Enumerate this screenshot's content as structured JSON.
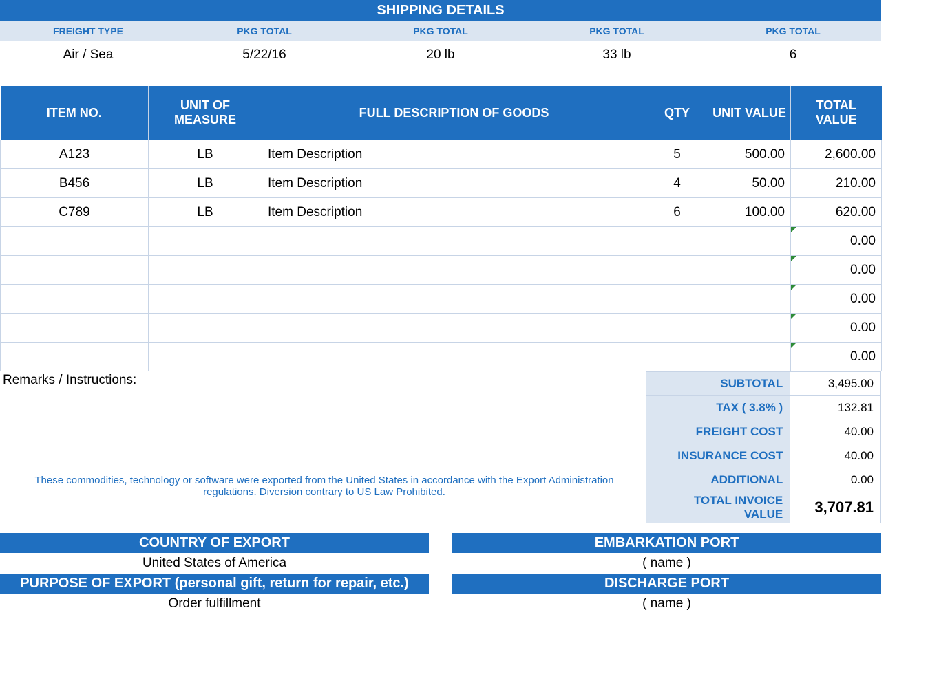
{
  "shipping": {
    "title": "SHIPPING DETAILS",
    "headers": [
      "FREIGHT TYPE",
      "PKG TOTAL",
      "PKG TOTAL",
      "PKG TOTAL",
      "PKG TOTAL"
    ],
    "values": [
      "Air / Sea",
      "5/22/16",
      "20 lb",
      "33 lb",
      "6"
    ]
  },
  "items_table": {
    "headers": {
      "item": "ITEM NO.",
      "uom": "UNIT OF MEASURE",
      "desc": "FULL DESCRIPTION OF GOODS",
      "qty": "QTY",
      "uval": "UNIT VALUE",
      "tval": "TOTAL VALUE"
    },
    "rows": [
      {
        "item": "A123",
        "uom": "LB",
        "desc": "Item Description",
        "qty": "5",
        "uval": "500.00",
        "tval": "2,600.00"
      },
      {
        "item": "B456",
        "uom": "LB",
        "desc": "Item Description",
        "qty": "4",
        "uval": "50.00",
        "tval": "210.00"
      },
      {
        "item": "C789",
        "uom": "LB",
        "desc": "Item Description",
        "qty": "6",
        "uval": "100.00",
        "tval": "620.00"
      },
      {
        "item": "",
        "uom": "",
        "desc": "",
        "qty": "",
        "uval": "",
        "tval": "0.00",
        "flag": true
      },
      {
        "item": "",
        "uom": "",
        "desc": "",
        "qty": "",
        "uval": "",
        "tval": "0.00",
        "flag": true
      },
      {
        "item": "",
        "uom": "",
        "desc": "",
        "qty": "",
        "uval": "",
        "tval": "0.00",
        "flag": true
      },
      {
        "item": "",
        "uom": "",
        "desc": "",
        "qty": "",
        "uval": "",
        "tval": "0.00",
        "flag": true
      },
      {
        "item": "",
        "uom": "",
        "desc": "",
        "qty": "",
        "uval": "",
        "tval": "0.00",
        "flag": true
      }
    ]
  },
  "remarks_label": "Remarks / Instructions:",
  "export_note": "These commodities, technology or software were exported from the United States in accordance with the Export Administration regulations.  Diversion contrary to US Law Prohibited.",
  "totals": {
    "subtotal": {
      "label": "SUBTOTAL",
      "value": "3,495.00"
    },
    "tax": {
      "label": "TAX ( 3.8% )",
      "value": "132.81"
    },
    "freight": {
      "label": "FREIGHT COST",
      "value": "40.00"
    },
    "insurance": {
      "label": "INSURANCE COST",
      "value": "40.00"
    },
    "additional": {
      "label": "ADDITIONAL",
      "value": "0.00"
    },
    "grand": {
      "label": "TOTAL INVOICE VALUE",
      "value": "3,707.81"
    }
  },
  "footer": {
    "country_label": "COUNTRY OF EXPORT",
    "country_value": "United States of America",
    "embark_label": "EMBARKATION PORT",
    "embark_value": "( name )",
    "purpose_label": "PURPOSE OF EXPORT (personal gift, return for repair, etc.)",
    "purpose_value": "Order fulfillment",
    "discharge_label": "DISCHARGE PORT",
    "discharge_value": "( name )"
  }
}
